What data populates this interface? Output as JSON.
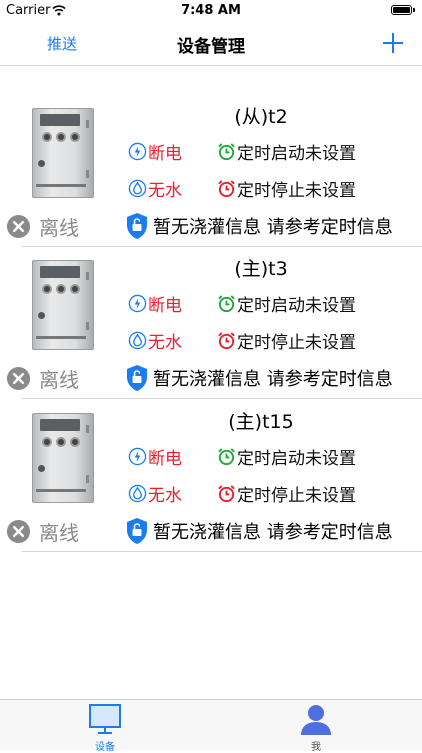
{
  "status_bar": {
    "carrier": "Carrier",
    "time": "7:48 AM"
  },
  "nav": {
    "push_label": "推送",
    "title": "设备管理",
    "add_icon": "plus-icon"
  },
  "devices": [
    {
      "name": "(从)t2",
      "power_status": "断电",
      "water_status": "无水",
      "timer_start": "定时启动未设置",
      "timer_stop": "定时停止未设置",
      "connection": "离线",
      "irrigation": "暂无浇灌信息 请参考定时信息"
    },
    {
      "name": "(主)t3",
      "power_status": "断电",
      "water_status": "无水",
      "timer_start": "定时启动未设置",
      "timer_stop": "定时停止未设置",
      "connection": "离线",
      "irrigation": "暂无浇灌信息 请参考定时信息"
    },
    {
      "name": "(主)t15",
      "power_status": "断电",
      "water_status": "无水",
      "timer_start": "定时启动未设置",
      "timer_stop": "定时停止未设置",
      "connection": "离线",
      "irrigation": "暂无浇灌信息 请参考定时信息"
    }
  ],
  "tabbar": {
    "items": [
      {
        "label": "设备",
        "icon": "monitor-icon",
        "active": true
      },
      {
        "label": "我",
        "icon": "person-icon",
        "active": false
      }
    ]
  },
  "colors": {
    "accent": "#1b7cf2",
    "alert_red": "#e8212f",
    "timer_green": "#22a83a",
    "offline_gray": "#8a8a8a"
  }
}
